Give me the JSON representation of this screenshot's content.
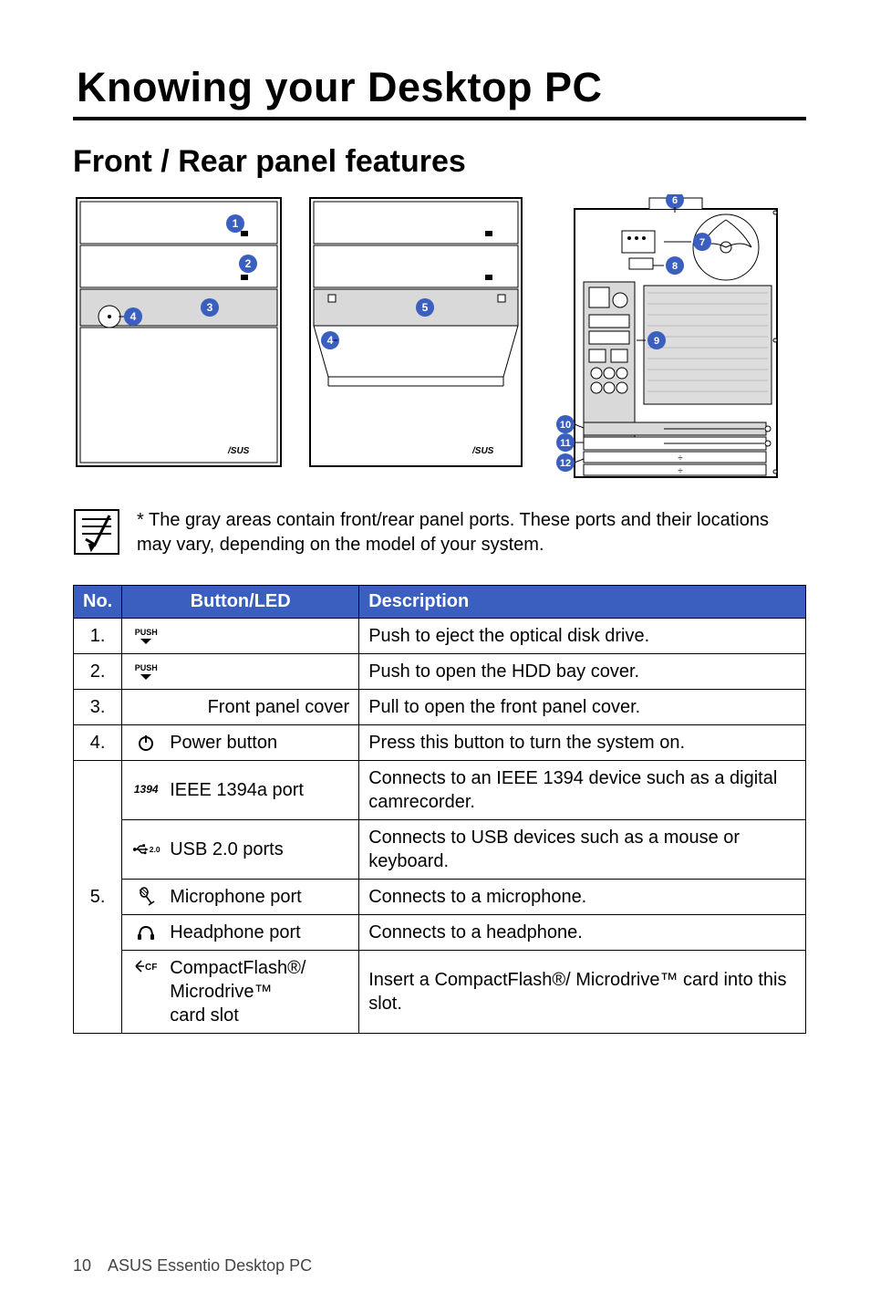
{
  "doc_title": "Knowing your Desktop PC",
  "section_title": "Front / Rear panel features",
  "note": "* The gray areas contain front/rear panel ports. These ports and their locations may vary, depending on the model of your system.",
  "headers": {
    "no": "No.",
    "btn": "Button/LED",
    "desc": "Description"
  },
  "callouts": [
    "1",
    "2",
    "3",
    "4",
    "5",
    "6",
    "7",
    "8",
    "9",
    "10",
    "11",
    "12"
  ],
  "rows": {
    "r1": {
      "num": "1.",
      "label": "PUSH",
      "desc": "Push to eject the optical disk drive."
    },
    "r2": {
      "num": "2.",
      "label": "PUSH",
      "desc": "Push to open the HDD bay cover."
    },
    "r3": {
      "num": "3.",
      "label": "Front panel cover",
      "desc": "Pull to open the front panel cover."
    },
    "r4": {
      "num": "4.",
      "label": "Power button",
      "desc": "Press this button to turn the system on."
    },
    "r5_1": {
      "label": "IEEE 1394a port",
      "glyph": "1394",
      "desc": "Connects to an IEEE 1394 device such as a digital camrecorder."
    },
    "r5_2": {
      "label": "USB 2.0 ports",
      "glyph": "2.0",
      "desc": "Connects to USB devices such as a mouse or keyboard."
    },
    "r5_3": {
      "label": "Microphone port",
      "desc": "Connects to a microphone."
    },
    "r5_4": {
      "label": "Headphone port",
      "desc": "Connects to a headphone."
    },
    "r5_5": {
      "label": "CompactFlash®/\nMicrodrive™\ncard slot",
      "glyph": "CF",
      "desc": "Insert a CompactFlash®/ Microdrive™ card into this slot."
    },
    "r5num": "5."
  },
  "footer": {
    "page": "10",
    "product": "ASUS Essentio Desktop PC"
  }
}
